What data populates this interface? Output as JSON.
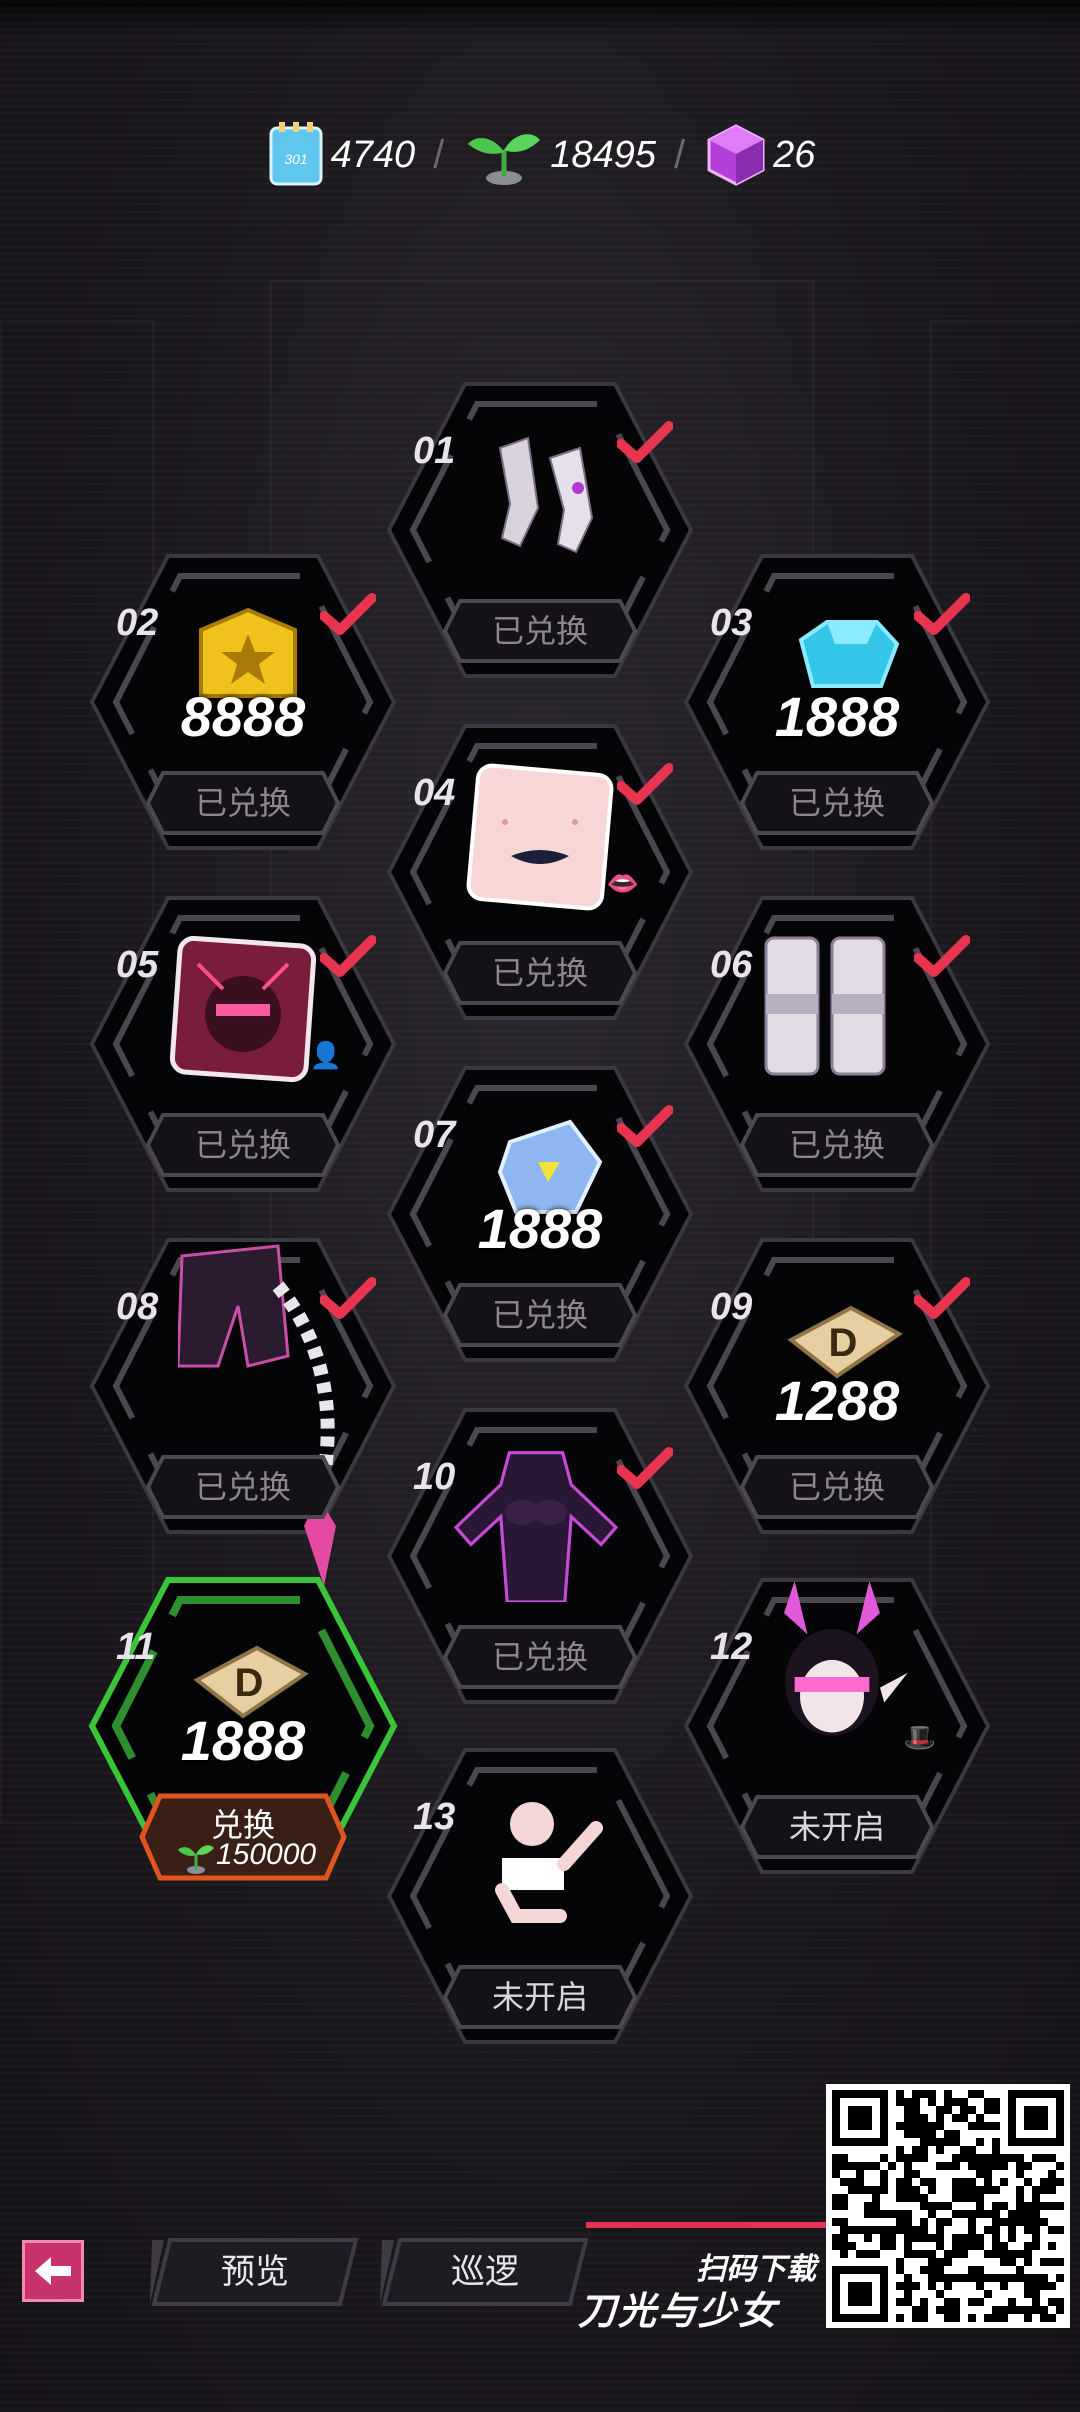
{
  "currencies": [
    {
      "name": "ticket",
      "icon": "ticket-icon",
      "value": "4740"
    },
    {
      "name": "sprout",
      "icon": "sprout-icon",
      "value": "18495"
    },
    {
      "name": "crystal",
      "icon": "purple-cube-icon",
      "value": "26"
    }
  ],
  "separator": "/",
  "items": [
    {
      "num": "01",
      "status": "已兑换",
      "icon": "mech-gloves-icon",
      "redeemed": true
    },
    {
      "num": "02",
      "status": "已兑换",
      "icon": "gold-badge-icon",
      "amount": "8888",
      "redeemed": true
    },
    {
      "num": "03",
      "status": "已兑换",
      "icon": "blue-gem-icon",
      "amount": "1888",
      "redeemed": true
    },
    {
      "num": "04",
      "status": "已兑换",
      "icon": "lips-makeup-icon",
      "redeemed": true
    },
    {
      "num": "05",
      "status": "已兑换",
      "icon": "avatar-portrait-icon",
      "redeemed": true
    },
    {
      "num": "06",
      "status": "已兑换",
      "icon": "mech-boots-icon",
      "redeemed": true
    },
    {
      "num": "07",
      "status": "已兑换",
      "icon": "crystal-card-icon",
      "amount": "1888",
      "redeemed": true
    },
    {
      "num": "08",
      "status": "已兑换",
      "icon": "tail-outfit-icon",
      "redeemed": true
    },
    {
      "num": "09",
      "status": "已兑换",
      "icon": "d-coin-icon",
      "amount": "1288",
      "redeemed": true
    },
    {
      "num": "10",
      "status": "已兑换",
      "icon": "bodysuit-icon",
      "redeemed": true
    },
    {
      "num": "11",
      "icon": "d-coin-icon",
      "amount": "1888",
      "action": "兑换",
      "cost": "150000",
      "current": true
    },
    {
      "num": "12",
      "status": "未开启",
      "icon": "horned-hair-icon",
      "redeemed": false
    },
    {
      "num": "13",
      "status": "未开启",
      "icon": "pose-icon",
      "redeemed": false
    }
  ],
  "bottom": {
    "back_icon": "back-arrow-icon",
    "preview": "预览",
    "patrol": "巡逻",
    "scan_download": "扫码下载",
    "brand": "刀光与少女"
  },
  "colors": {
    "check": "#e8354f",
    "current_border": "#3ac43a",
    "accent": "#c8326e",
    "gold": "#f2c21c",
    "gem": "#34c6e8"
  }
}
